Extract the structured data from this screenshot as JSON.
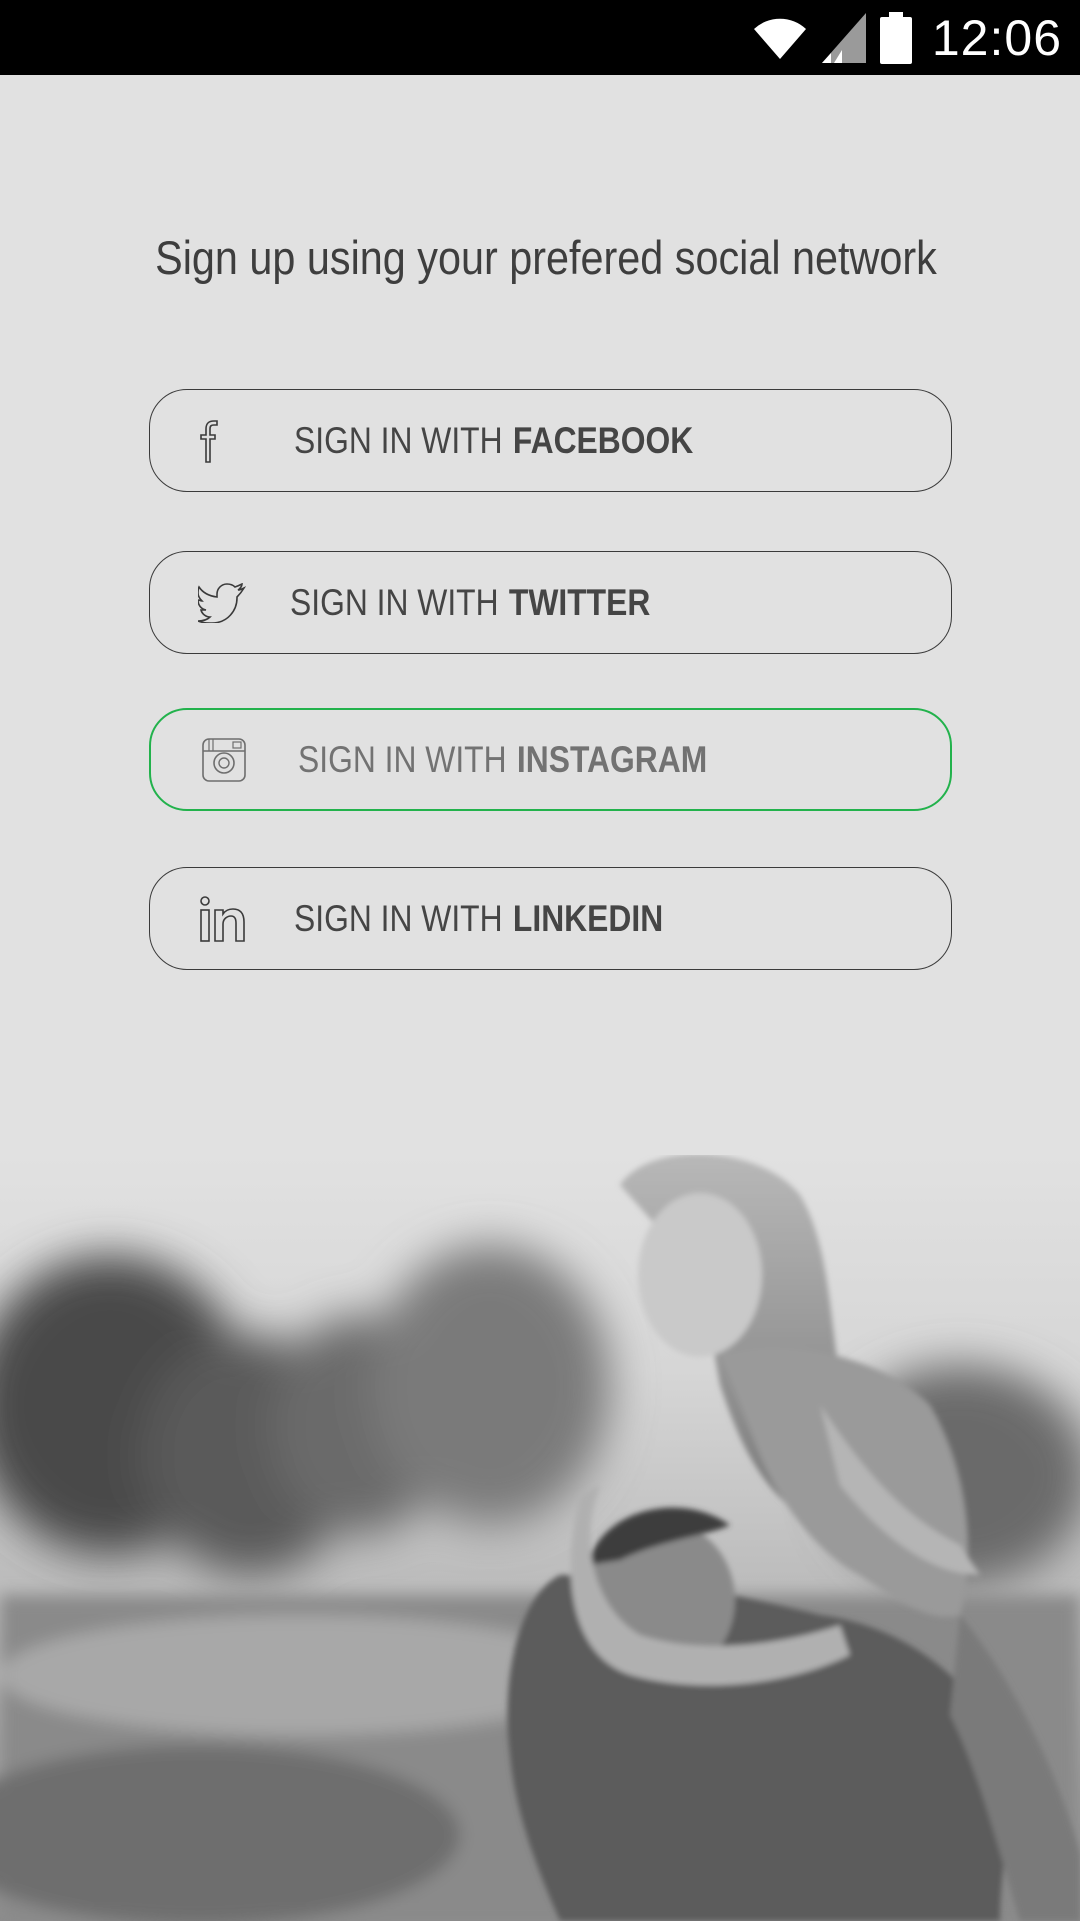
{
  "status_bar": {
    "time": "12:06",
    "icons": [
      "wifi-icon",
      "signal-icon",
      "battery-icon"
    ]
  },
  "headline": "Sign up using your prefered social network",
  "buttons": [
    {
      "prefix": "SIGN IN WITH",
      "network": "FACEBOOK",
      "icon": "facebook-icon",
      "active": false
    },
    {
      "prefix": "SIGN IN WITH",
      "network": "TWITTER",
      "icon": "twitter-icon",
      "active": false
    },
    {
      "prefix": "SIGN IN WITH",
      "network": "INSTAGRAM",
      "icon": "instagram-icon",
      "active": true
    },
    {
      "prefix": "SIGN IN WITH",
      "network": "LINKEDIN",
      "icon": "linkedin-icon",
      "active": false
    }
  ],
  "colors": {
    "background": "#e1e1e1",
    "status_bar": "#000000",
    "text": "#3e3e3e",
    "button_border": "#3a3a3a",
    "active_border": "#22b24c"
  },
  "background_photo": "background-photo-couple"
}
